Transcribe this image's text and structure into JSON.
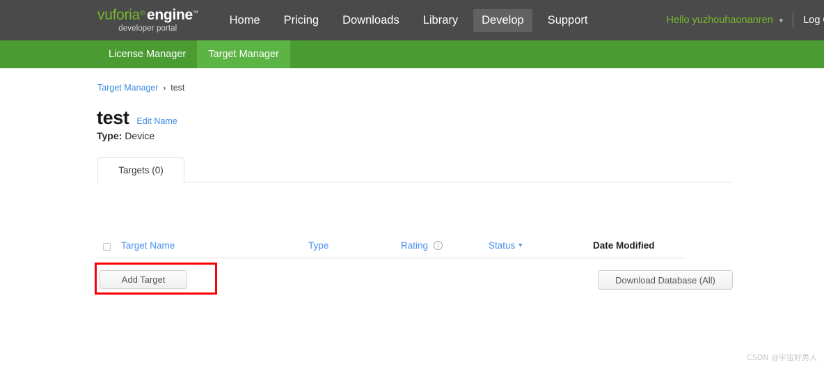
{
  "topnav": {
    "logo": {
      "brand": "vuforia",
      "registered_mark": "®",
      "product": "engine",
      "trademark": "™",
      "tagline": "developer portal"
    },
    "items": [
      {
        "label": "Home",
        "active": false
      },
      {
        "label": "Pricing",
        "active": false
      },
      {
        "label": "Downloads",
        "active": false
      },
      {
        "label": "Library",
        "active": false
      },
      {
        "label": "Develop",
        "active": true
      },
      {
        "label": "Support",
        "active": false
      }
    ],
    "user_greeting": "Hello yuzhouhaonanren",
    "user_caret_icon": "chevron-down-icon",
    "logout_label": "Log Out"
  },
  "subnav": {
    "tabs": [
      {
        "label": "License Manager",
        "active": false
      },
      {
        "label": "Target Manager",
        "active": true
      }
    ]
  },
  "breadcrumb": {
    "parent": "Target Manager",
    "separator": "›",
    "current": "test"
  },
  "page": {
    "title": "test",
    "edit_name_label": "Edit Name",
    "type_label": "Type:",
    "type_value": "Device"
  },
  "tabs": {
    "targets": "Targets (0)"
  },
  "actions": {
    "add_target_label": "Add Target",
    "download_db_label": "Download Database (All)"
  },
  "table": {
    "select_all_checkbox": "select-all-checkbox",
    "columns": [
      {
        "label": "Target Name",
        "style": "link",
        "icon": null
      },
      {
        "label": "Type",
        "style": "link",
        "icon": null
      },
      {
        "label": "Rating",
        "style": "link",
        "icon": "info-icon"
      },
      {
        "label": "Status",
        "style": "link",
        "icon": "chevron-down-icon"
      },
      {
        "label": "Date Modified",
        "style": "plain",
        "icon": null
      }
    ],
    "rows": []
  },
  "annotation": {
    "highlight_color": "#fb0007",
    "target": "add-target-button"
  },
  "watermark": "CSDN @宇宙好男人",
  "colors": {
    "topnav_bg": "#4a4a4a",
    "topnav_active": "#616161",
    "green_bar": "#4a9b32",
    "green_active": "#5cb444",
    "brand_green": "#76b82a",
    "link_blue": "#3f8ae0",
    "table_link_blue": "#4a90ee"
  }
}
